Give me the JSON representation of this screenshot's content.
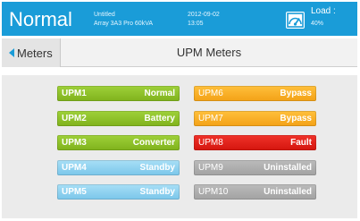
{
  "header": {
    "mode": "Normal",
    "name": "Untitled",
    "model": "Array 3A3 Pro 60kVA",
    "date": "2012-09-02",
    "time": "13:05",
    "load_label": "Load :",
    "load_value": "40%",
    "load_icon": "load-meter-icon"
  },
  "nav": {
    "back_label": "Meters",
    "back_icon": "back-arrow-icon",
    "title": "UPM Meters"
  },
  "colors": {
    "header": "#1a9cd8",
    "normal": "#8cc22a",
    "bypass": "#f9ad22",
    "fault": "#e3221b",
    "standby": "#8fd2f0",
    "uninstalled": "#adadad"
  },
  "upms": [
    {
      "id": "UPM1",
      "status": "Normal"
    },
    {
      "id": "UPM2",
      "status": "Battery"
    },
    {
      "id": "UPM3",
      "status": "Converter"
    },
    {
      "id": "UPM4",
      "status": "Standby"
    },
    {
      "id": "UPM5",
      "status": "Standby"
    },
    {
      "id": "UPM6",
      "status": "Bypass"
    },
    {
      "id": "UPM7",
      "status": "Bypass"
    },
    {
      "id": "UPM8",
      "status": "Fault"
    },
    {
      "id": "UPM9",
      "status": "Uninstalled"
    },
    {
      "id": "UPM10",
      "status": "Uninstalled"
    }
  ]
}
